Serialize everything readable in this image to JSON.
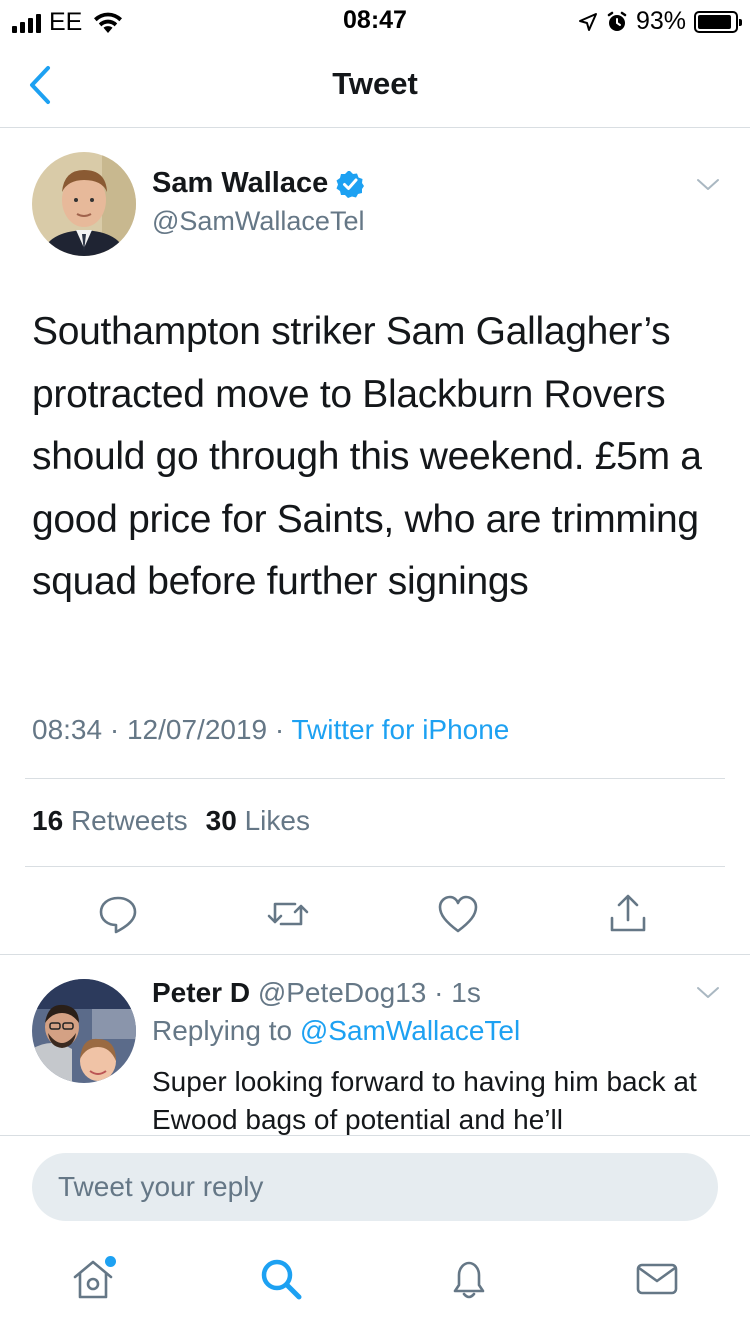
{
  "status_bar": {
    "carrier": "EE",
    "time": "08:47",
    "battery_percent": "93%",
    "battery_level": 0.93
  },
  "nav": {
    "title": "Tweet",
    "back_icon": "chevron-left-icon"
  },
  "tweet": {
    "author_name": "Sam Wallace",
    "author_handle": "@SamWallaceTel",
    "verified": true,
    "text": "Southampton striker Sam Gallagher’s protracted move to Blackburn Rovers should go through this weekend. £5m a good price for Saints, who are trimming squad before further signings",
    "time": "08:34",
    "date": "12/07/2019",
    "meta_sep_1": " · ",
    "meta_sep_2": " · ",
    "source": "Twitter for iPhone",
    "retweets_count": "16",
    "retweets_label": "Retweets",
    "likes_count": "30",
    "likes_label": "Likes",
    "actions": [
      "reply-icon",
      "retweet-icon",
      "like-icon",
      "share-icon"
    ]
  },
  "reply": {
    "author_name": "Peter D",
    "author_handle": "@PeteDog13",
    "sep": " · ",
    "time": "1s",
    "replying_label": "Replying to",
    "replying_to": "@SamWallaceTel",
    "text": "Super looking forward to having him back at Ewood bags of potential and he’ll"
  },
  "compose": {
    "placeholder": "Tweet your reply"
  },
  "tabbar": {
    "tabs": [
      "home-icon",
      "search-icon",
      "notifications-icon",
      "messages-icon"
    ],
    "active": "search-icon"
  },
  "colors": {
    "accent": "#1da1f2",
    "secondary_text": "#657786",
    "divider": "#d9dee2",
    "input_bg": "#e6ecf0"
  }
}
